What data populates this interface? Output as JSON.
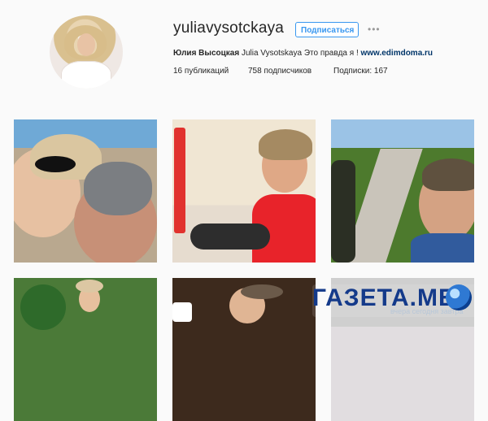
{
  "profile": {
    "username": "yuliavysotckaya",
    "subscribe_label": "Подписаться",
    "more_label": "•••",
    "bio": {
      "name": "Юлия Высоцкая",
      "text": "Julia Vysotskaya Это правда я !",
      "link": "www.edimdoma.ru"
    },
    "stats": {
      "posts": "16 публикаций",
      "followers": "758 подписчиков",
      "following": "Подписки: 167"
    }
  },
  "watermark": {
    "text": "ГАЗЕТА.ME",
    "subtitle": "вчера сегодня завтра"
  },
  "colors": {
    "accent": "#3897f0",
    "link": "#003569",
    "background": "#fafafa"
  }
}
